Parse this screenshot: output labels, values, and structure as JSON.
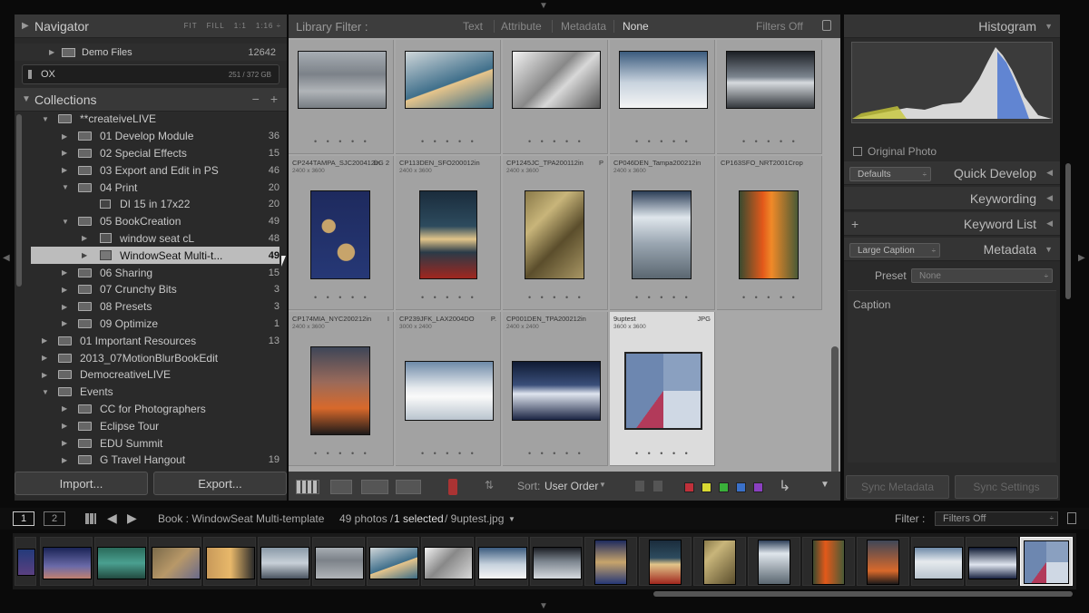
{
  "navigator": {
    "title": "Navigator",
    "options": [
      "FIT",
      "FILL",
      "1:1",
      "1:16 ÷"
    ]
  },
  "folders": {
    "demo_label": "Demo Files",
    "demo_count": "12642",
    "volume_label": "OX",
    "volume_capacity": "251 / 372 GB"
  },
  "collections": {
    "title": "Collections",
    "items": [
      {
        "label": "**createiveLIVE",
        "count": ""
      },
      {
        "label": "01 Develop Module",
        "count": "36"
      },
      {
        "label": "02 Special Effects",
        "count": "15"
      },
      {
        "label": "03 Export and Edit in PS",
        "count": "46"
      },
      {
        "label": "04 Print",
        "count": "20"
      },
      {
        "label": "DI 15 in 17x22",
        "count": "20"
      },
      {
        "label": "05 BookCreation",
        "count": "49"
      },
      {
        "label": "window seat cL",
        "count": "48"
      },
      {
        "label": "WindowSeat Multi-t...",
        "count": "49"
      },
      {
        "label": "06 Sharing",
        "count": "15"
      },
      {
        "label": "07 Crunchy Bits",
        "count": "3"
      },
      {
        "label": "08 Presets",
        "count": "3"
      },
      {
        "label": "09 Optimize",
        "count": "1"
      },
      {
        "label": "01 Important Resources",
        "count": "13"
      },
      {
        "label": "2013_07MotionBlurBookEdit",
        "count": ""
      },
      {
        "label": "DemocreativeLIVE",
        "count": ""
      },
      {
        "label": "Events",
        "count": ""
      },
      {
        "label": "CC for Photographers",
        "count": ""
      },
      {
        "label": "Eclipse Tour",
        "count": ""
      },
      {
        "label": "EDU Summit",
        "count": ""
      },
      {
        "label": "G Travel Hangout",
        "count": "19"
      }
    ]
  },
  "buttons": {
    "import": "Import...",
    "export": "Export..."
  },
  "library_filter": {
    "title": "Library Filter :",
    "text": "Text",
    "attribute": "Attribute",
    "metadata": "Metadata",
    "none": "None",
    "filters_off": "Filters Off"
  },
  "grid": {
    "row2": [
      {
        "name": "CP244TAMPA_SJC200412in",
        "dims": "2400 x 3600",
        "ext": "DG 2"
      },
      {
        "name": "CP113DEN_SFO200012in",
        "dims": "2400 x 3600",
        "ext": ""
      },
      {
        "name": "CP1245JC_TPA200112in",
        "dims": "2400 x 3600",
        "ext": "P"
      },
      {
        "name": "CP046DEN_Tampa200212in",
        "dims": "2400 x 3600",
        "ext": ""
      },
      {
        "name": "CP163SFO_NRT2001Crop",
        "dims": "",
        "ext": ""
      }
    ],
    "row3": [
      {
        "name": "CP174MIA_NYC200212in",
        "dims": "2400 x 3600",
        "ext": "I"
      },
      {
        "name": "CP239JFK_LAX2004DO",
        "dims": "3000 x 2400",
        "ext": "P."
      },
      {
        "name": "CP001DEN_TPA200212in",
        "dims": "2400 x 2400",
        "ext": ""
      },
      {
        "name": "9uptest",
        "dims": "3600 x 3600",
        "ext": "JPG"
      }
    ]
  },
  "toolbar": {
    "sort_label": "Sort:",
    "sort_value": "User Order"
  },
  "right": {
    "histogram": "Histogram",
    "original_photo": "Original Photo",
    "defaults": "Defaults",
    "quick_develop": "Quick Develop",
    "keywording": "Keywording",
    "keyword_list": "Keyword List",
    "large_caption": "Large Caption",
    "metadata": "Metadata",
    "preset_label": "Preset",
    "preset_value": "None",
    "caption": "Caption",
    "sync_metadata": "Sync Metadata",
    "sync_settings": "Sync Settings"
  },
  "bottombar": {
    "page1": "1",
    "page2": "2",
    "source": "Book : WindowSeat Multi-template",
    "photos": "49 photos /",
    "selected": "1 selected",
    "file": "/ 9uptest.jpg",
    "filter_label": "Filter :",
    "filter_value": "Filters Off"
  }
}
